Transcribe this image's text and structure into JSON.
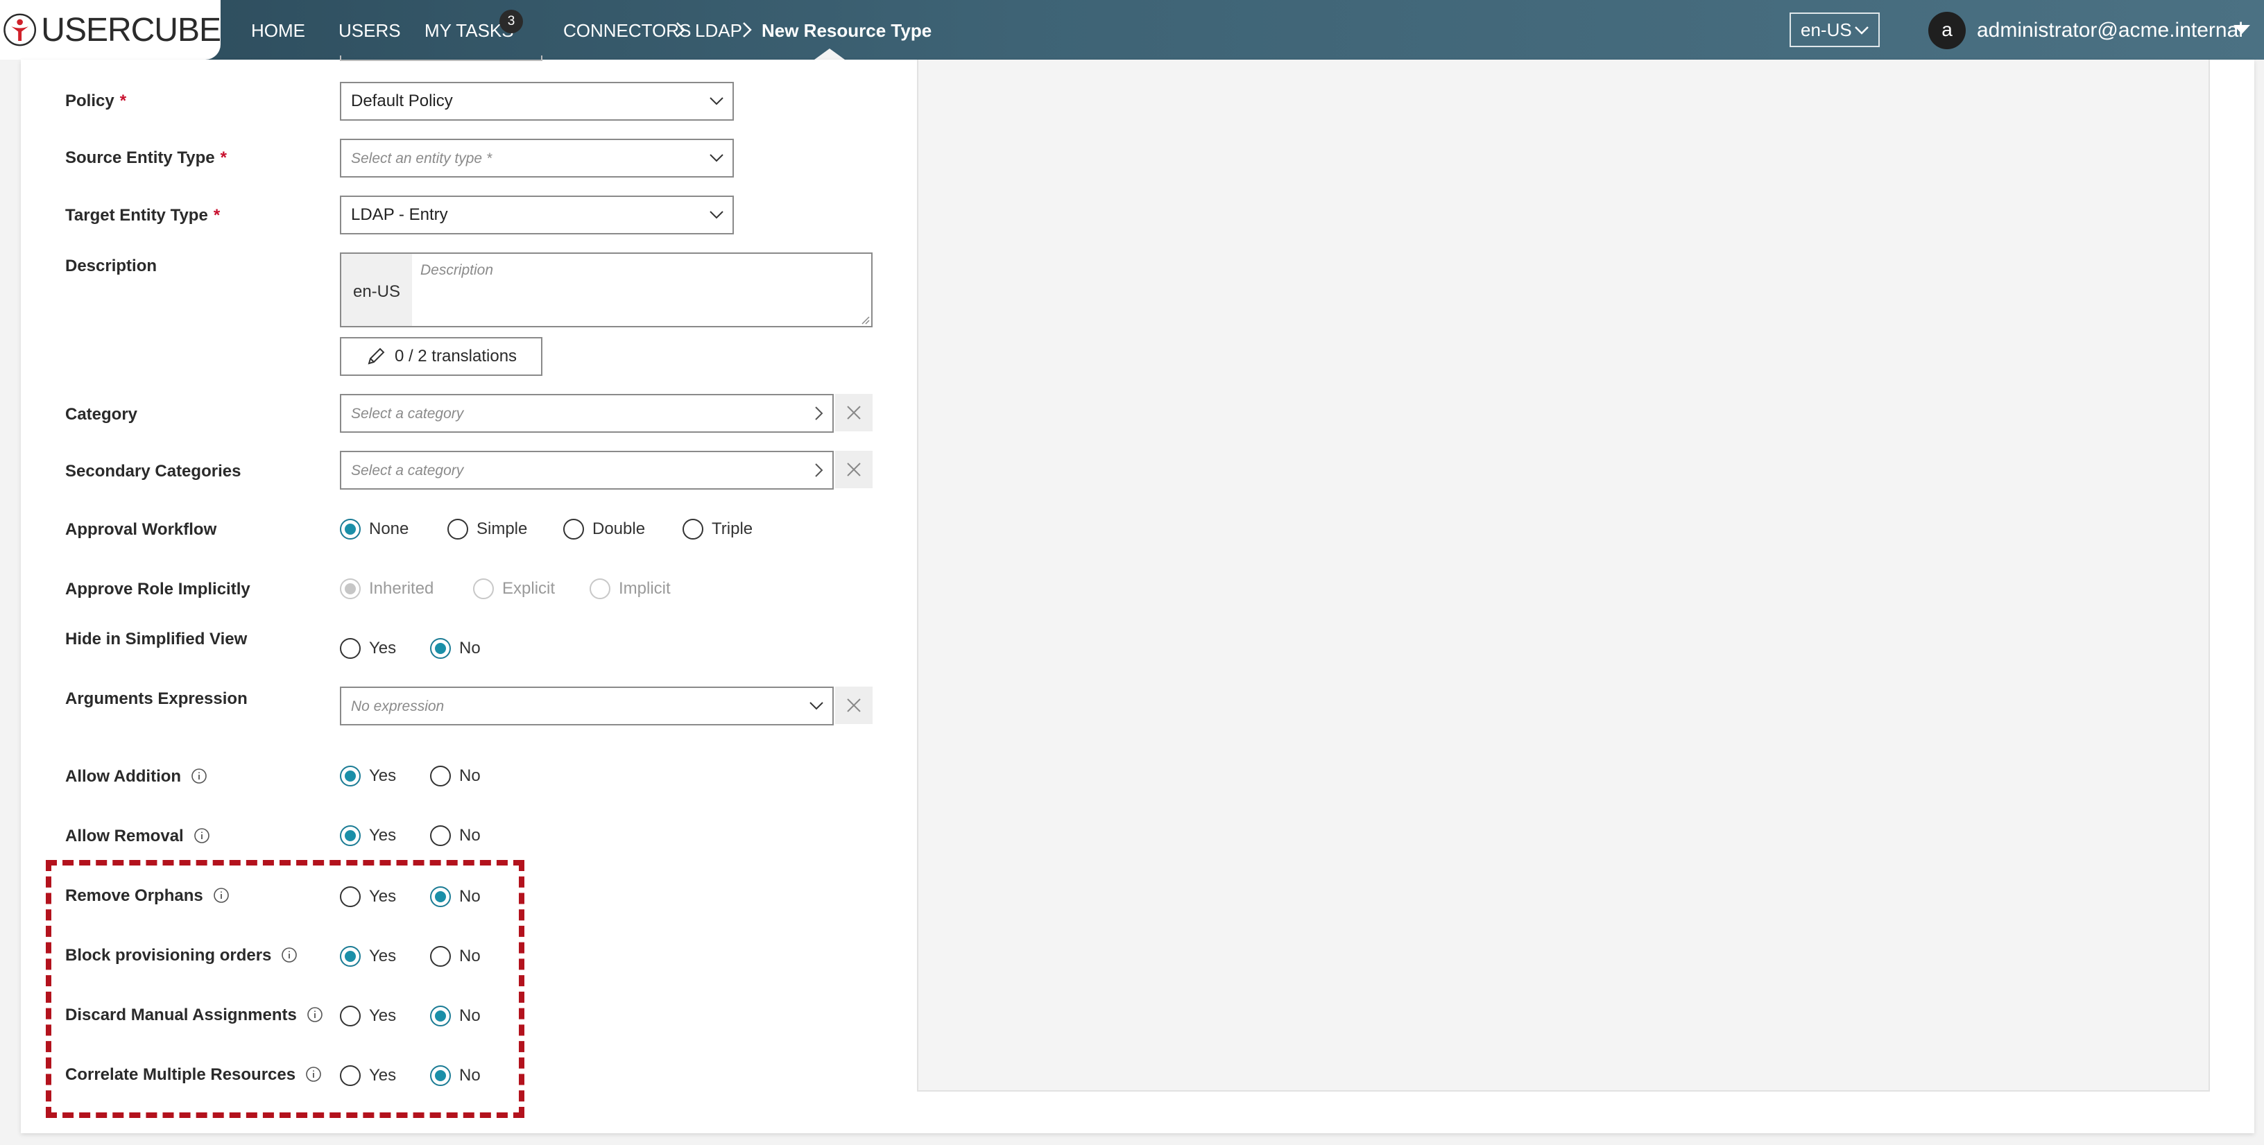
{
  "app": {
    "logo_text": "USERCUBE"
  },
  "nav": {
    "home": "HOME",
    "users": "USERS",
    "my_tasks": "MY TASKS",
    "my_tasks_count": "3"
  },
  "breadcrumb": {
    "connectors": "CONNECTORS",
    "ldap": "LDAP",
    "current": "New Resource Type"
  },
  "header": {
    "language": "en-US",
    "avatar_letter": "a",
    "user": "administrator@acme.internal"
  },
  "form": {
    "required_mark": "*",
    "policy": {
      "label": "Policy",
      "value": "Default Policy"
    },
    "source_entity_type": {
      "label": "Source Entity Type",
      "placeholder": "Select an entity type *"
    },
    "target_entity_type": {
      "label": "Target Entity Type",
      "value": "LDAP - Entry"
    },
    "description": {
      "label": "Description",
      "lang": "en-US",
      "placeholder": "Description",
      "translations": "0 / 2 translations"
    },
    "category": {
      "label": "Category",
      "placeholder": "Select a category"
    },
    "secondary_categories": {
      "label": "Secondary Categories",
      "placeholder": "Select a category"
    },
    "approval_workflow": {
      "label": "Approval Workflow",
      "options": [
        "None",
        "Simple",
        "Double",
        "Triple"
      ],
      "selected": "None"
    },
    "approve_role_implicitly": {
      "label": "Approve Role Implicitly",
      "options": [
        "Inherited",
        "Explicit",
        "Implicit"
      ],
      "selected": "Inherited",
      "disabled": true
    },
    "hide_in_simplified_view": {
      "label": "Hide in Simplified View",
      "options": [
        "Yes",
        "No"
      ],
      "selected": "No"
    },
    "arguments_expression": {
      "label": "Arguments Expression",
      "placeholder": "No expression"
    },
    "allow_addition": {
      "label": "Allow Addition",
      "options": [
        "Yes",
        "No"
      ],
      "selected": "Yes"
    },
    "allow_removal": {
      "label": "Allow Removal",
      "options": [
        "Yes",
        "No"
      ],
      "selected": "Yes"
    },
    "remove_orphans": {
      "label": "Remove Orphans",
      "options": [
        "Yes",
        "No"
      ],
      "selected": "No"
    },
    "block_provisioning_orders": {
      "label": "Block provisioning orders",
      "options": [
        "Yes",
        "No"
      ],
      "selected": "Yes"
    },
    "discard_manual_assignments": {
      "label": "Discard Manual Assignments",
      "options": [
        "Yes",
        "No"
      ],
      "selected": "No"
    },
    "correlate_multiple_resources": {
      "label": "Correlate Multiple Resources",
      "options": [
        "Yes",
        "No"
      ],
      "selected": "No"
    }
  },
  "colors": {
    "accent": "#1a8fa8",
    "required": "#c8102e",
    "highlight": "#b3121d",
    "header_dark": "#2b4a5a"
  }
}
